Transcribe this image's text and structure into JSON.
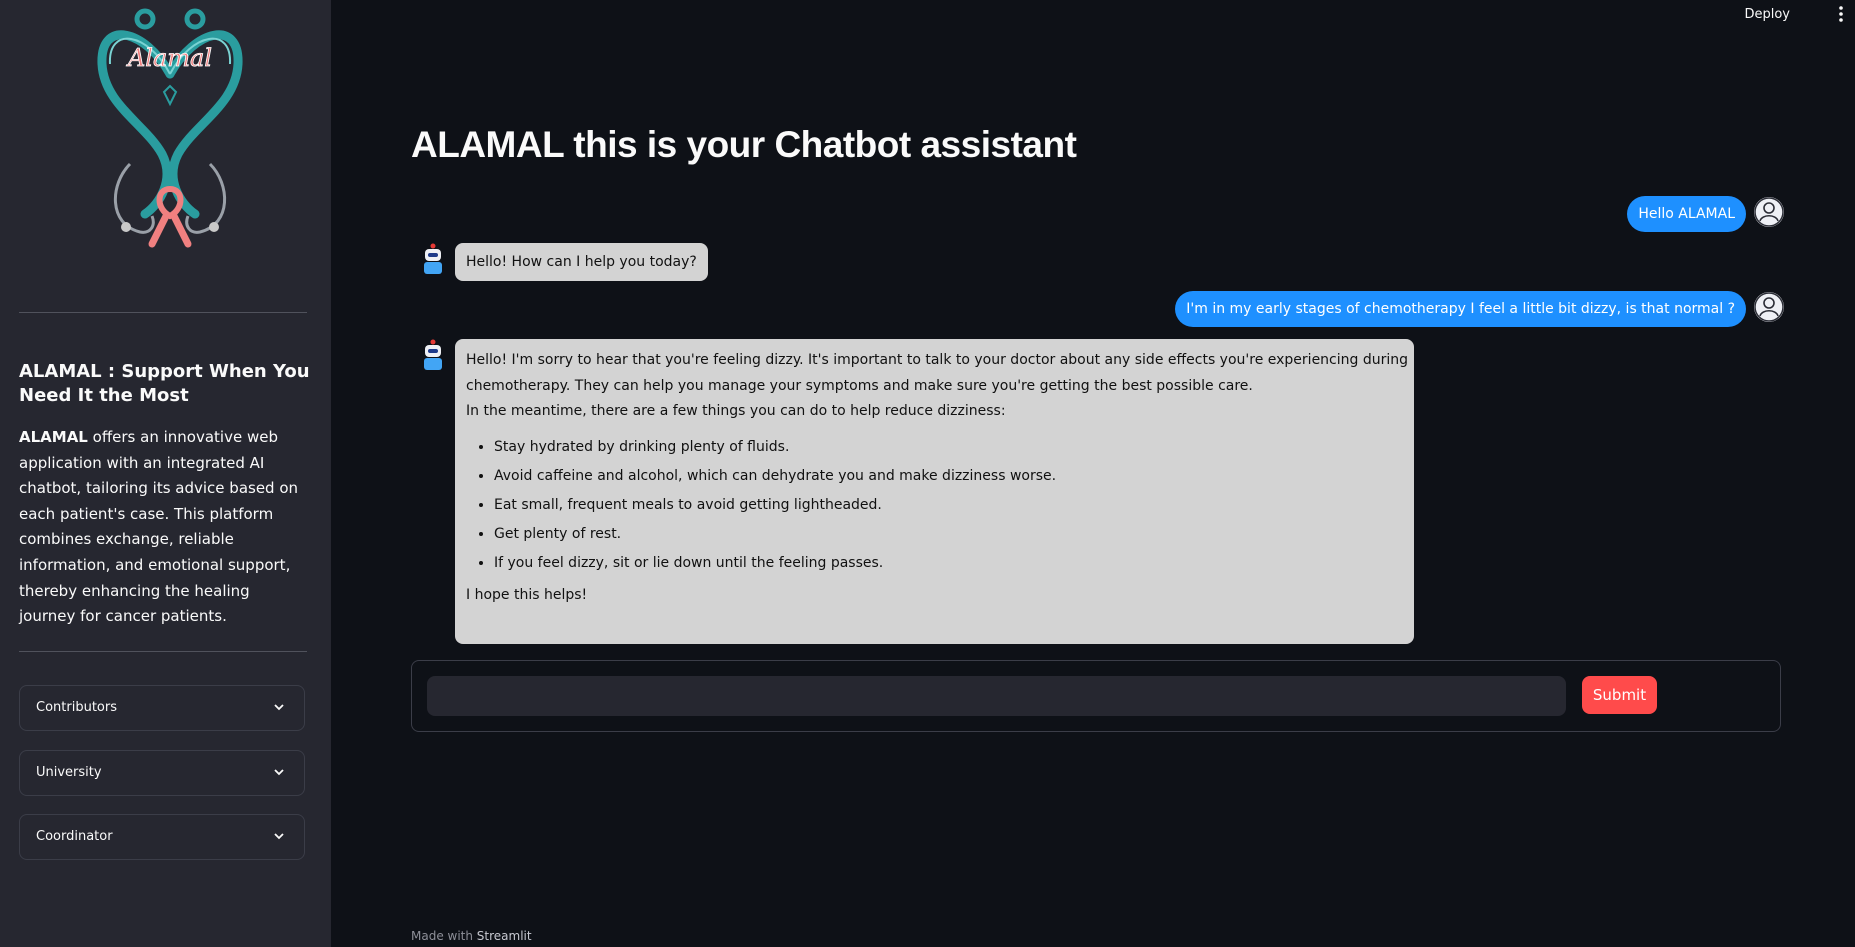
{
  "header": {
    "deploy_label": "Deploy",
    "menu_icon": "kebab-menu-icon"
  },
  "sidebar": {
    "logo": {
      "text": "Alamal",
      "icon": "stethoscope-heart-ribbon-logo",
      "colors": {
        "teal": "#2a9d9f",
        "pink": "#f08080"
      }
    },
    "heading": "ALAMAL : Support When You Need It the Most",
    "description_bold": "ALAMAL",
    "description_rest": " offers an innovative web application with an integrated AI chatbot, tailoring its advice based on each patient's case. This platform combines exchange, reliable information, and emotional support, thereby enhancing the healing journey for cancer patients.",
    "expanders": [
      {
        "label": "Contributors",
        "icon": "chevron-down-icon"
      },
      {
        "label": "University",
        "icon": "chevron-down-icon"
      },
      {
        "label": "Coordinator",
        "icon": "chevron-down-icon"
      }
    ]
  },
  "main": {
    "title": "ALAMAL this is your Chatbot assistant",
    "messages": [
      {
        "role": "user",
        "text": "Hello ALAMAL"
      },
      {
        "role": "assistant",
        "text": "Hello! How can I help you today?"
      },
      {
        "role": "user",
        "text": "I'm in my early stages of chemotherapy I feel a little bit dizzy, is that normal ?"
      },
      {
        "role": "assistant",
        "intro_line1": "Hello! I'm sorry to hear that you're feeling dizzy. It's important to talk to your doctor about any side effects you're experiencing during",
        "intro_line2": "chemotherapy. They can help you manage your symptoms and make sure you're getting the best possible care.",
        "intro_line3": "In the meantime, there are a few things you can do to help reduce dizziness:",
        "tips": [
          "Stay hydrated by drinking plenty of fluids.",
          "Avoid caffeine and alcohol, which can dehydrate you and make dizziness worse.",
          "Eat small, frequent meals to avoid getting lightheaded.",
          "Get plenty of rest.",
          "If you feel dizzy, sit or lie down until the feeling passes."
        ],
        "closing": "I hope this helps!"
      }
    ],
    "input": {
      "value": "",
      "placeholder": ""
    },
    "submit_label": "Submit"
  },
  "footer": {
    "prefix": "Made with ",
    "link": "Streamlit"
  },
  "colors": {
    "background": "#0e1117",
    "sidebar": "#262730",
    "user_bubble": "#1e90ff",
    "bot_bubble": "#d3d3d3",
    "submit": "#ff4b4b"
  }
}
